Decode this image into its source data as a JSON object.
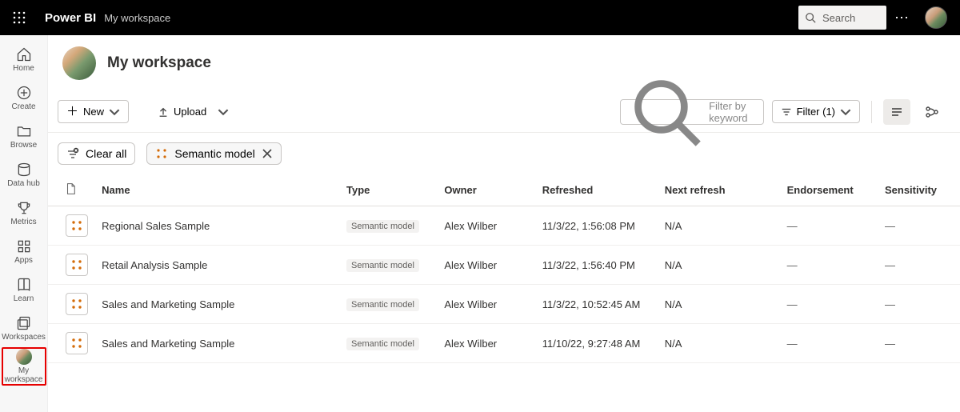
{
  "topbar": {
    "brand": "Power BI",
    "breadcrumb": "My workspace",
    "search_placeholder": "Search"
  },
  "rail": [
    {
      "key": "home",
      "label": "Home"
    },
    {
      "key": "create",
      "label": "Create"
    },
    {
      "key": "browse",
      "label": "Browse"
    },
    {
      "key": "datahub",
      "label": "Data hub"
    },
    {
      "key": "metrics",
      "label": "Metrics"
    },
    {
      "key": "apps",
      "label": "Apps"
    },
    {
      "key": "learn",
      "label": "Learn"
    },
    {
      "key": "workspaces",
      "label": "Workspaces"
    },
    {
      "key": "myworkspace",
      "label": "My workspace"
    }
  ],
  "workspace": {
    "title": "My workspace"
  },
  "toolbar": {
    "new_label": "New",
    "upload_label": "Upload",
    "filter_placeholder": "Filter by keyword",
    "filter_label": "Filter (1)"
  },
  "chips": {
    "clear_all": "Clear all",
    "applied": "Semantic model"
  },
  "columns": {
    "name": "Name",
    "type": "Type",
    "owner": "Owner",
    "refreshed": "Refreshed",
    "next_refresh": "Next refresh",
    "endorsement": "Endorsement",
    "sensitivity": "Sensitivity"
  },
  "rows": [
    {
      "name": "Regional Sales Sample",
      "type": "Semantic model",
      "owner": "Alex Wilber",
      "refreshed": "11/3/22, 1:56:08 PM",
      "next": "N/A",
      "endorse": "—",
      "sens": "—"
    },
    {
      "name": "Retail Analysis Sample",
      "type": "Semantic model",
      "owner": "Alex Wilber",
      "refreshed": "11/3/22, 1:56:40 PM",
      "next": "N/A",
      "endorse": "—",
      "sens": "—"
    },
    {
      "name": "Sales and Marketing Sample",
      "type": "Semantic model",
      "owner": "Alex Wilber",
      "refreshed": "11/3/22, 10:52:45 AM",
      "next": "N/A",
      "endorse": "—",
      "sens": "—"
    },
    {
      "name": "Sales and Marketing Sample",
      "type": "Semantic model",
      "owner": "Alex Wilber",
      "refreshed": "11/10/22, 9:27:48 AM",
      "next": "N/A",
      "endorse": "—",
      "sens": "—"
    }
  ]
}
